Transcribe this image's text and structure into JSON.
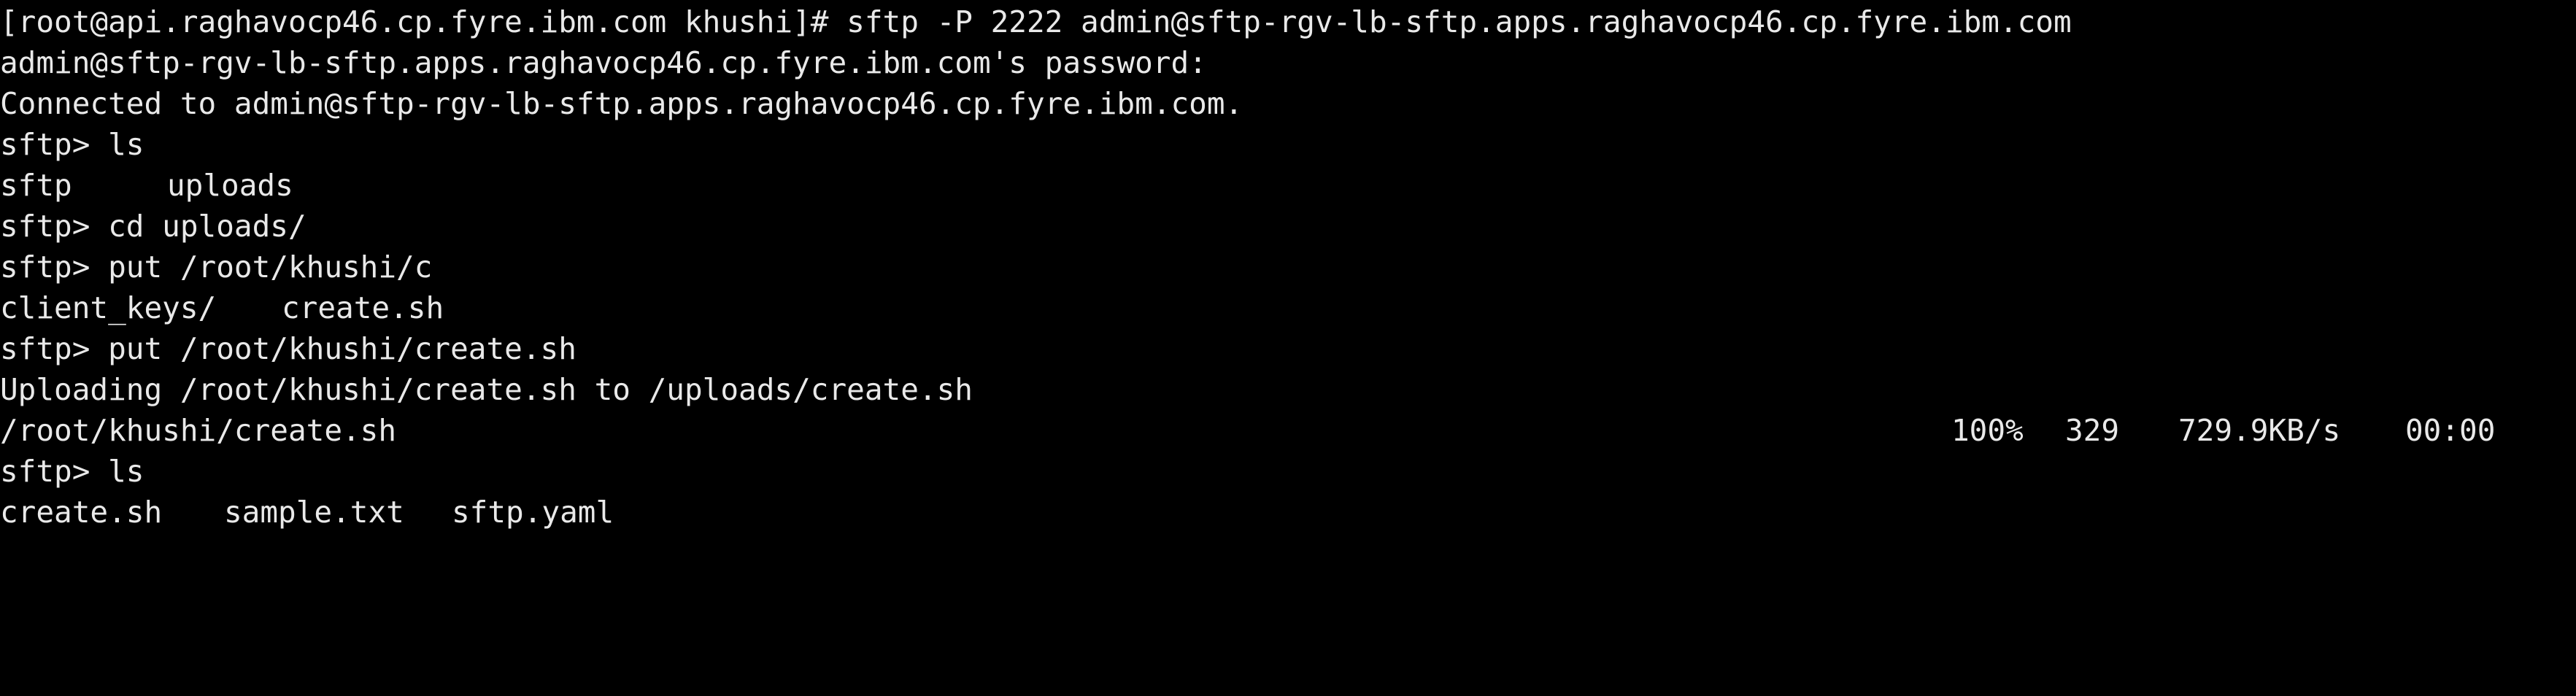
{
  "terminal": {
    "lines": {
      "l1": "[root@api.raghavocp46.cp.fyre.ibm.com khushi]# sftp -P 2222 admin@sftp-rgv-lb-sftp.apps.raghavocp46.cp.fyre.ibm.com",
      "l2": "admin@sftp-rgv-lb-sftp.apps.raghavocp46.cp.fyre.ibm.com's password:",
      "l3": "Connected to admin@sftp-rgv-lb-sftp.apps.raghavocp46.cp.fyre.ibm.com.",
      "l4": "sftp> ls",
      "l5": {
        "a": "sftp",
        "b": "uploads"
      },
      "l6": "sftp> cd uploads/",
      "l7": "sftp> put /root/khushi/c",
      "l8": {
        "a": "client_keys/",
        "b": "create.sh"
      },
      "l9": "sftp> put /root/khushi/create.sh",
      "l10": "Uploading /root/khushi/create.sh to /uploads/create.sh",
      "l11": {
        "file": "/root/khushi/create.sh",
        "percent": "100%",
        "size": "329",
        "rate": "729.9KB/s",
        "eta": "00:00"
      },
      "l12": "sftp> ls",
      "l13": {
        "a": "create.sh",
        "b": "sample.txt",
        "c": "sftp.yaml"
      }
    },
    "colors": {
      "background": "#000000",
      "foreground": "#e9e9e9"
    }
  }
}
